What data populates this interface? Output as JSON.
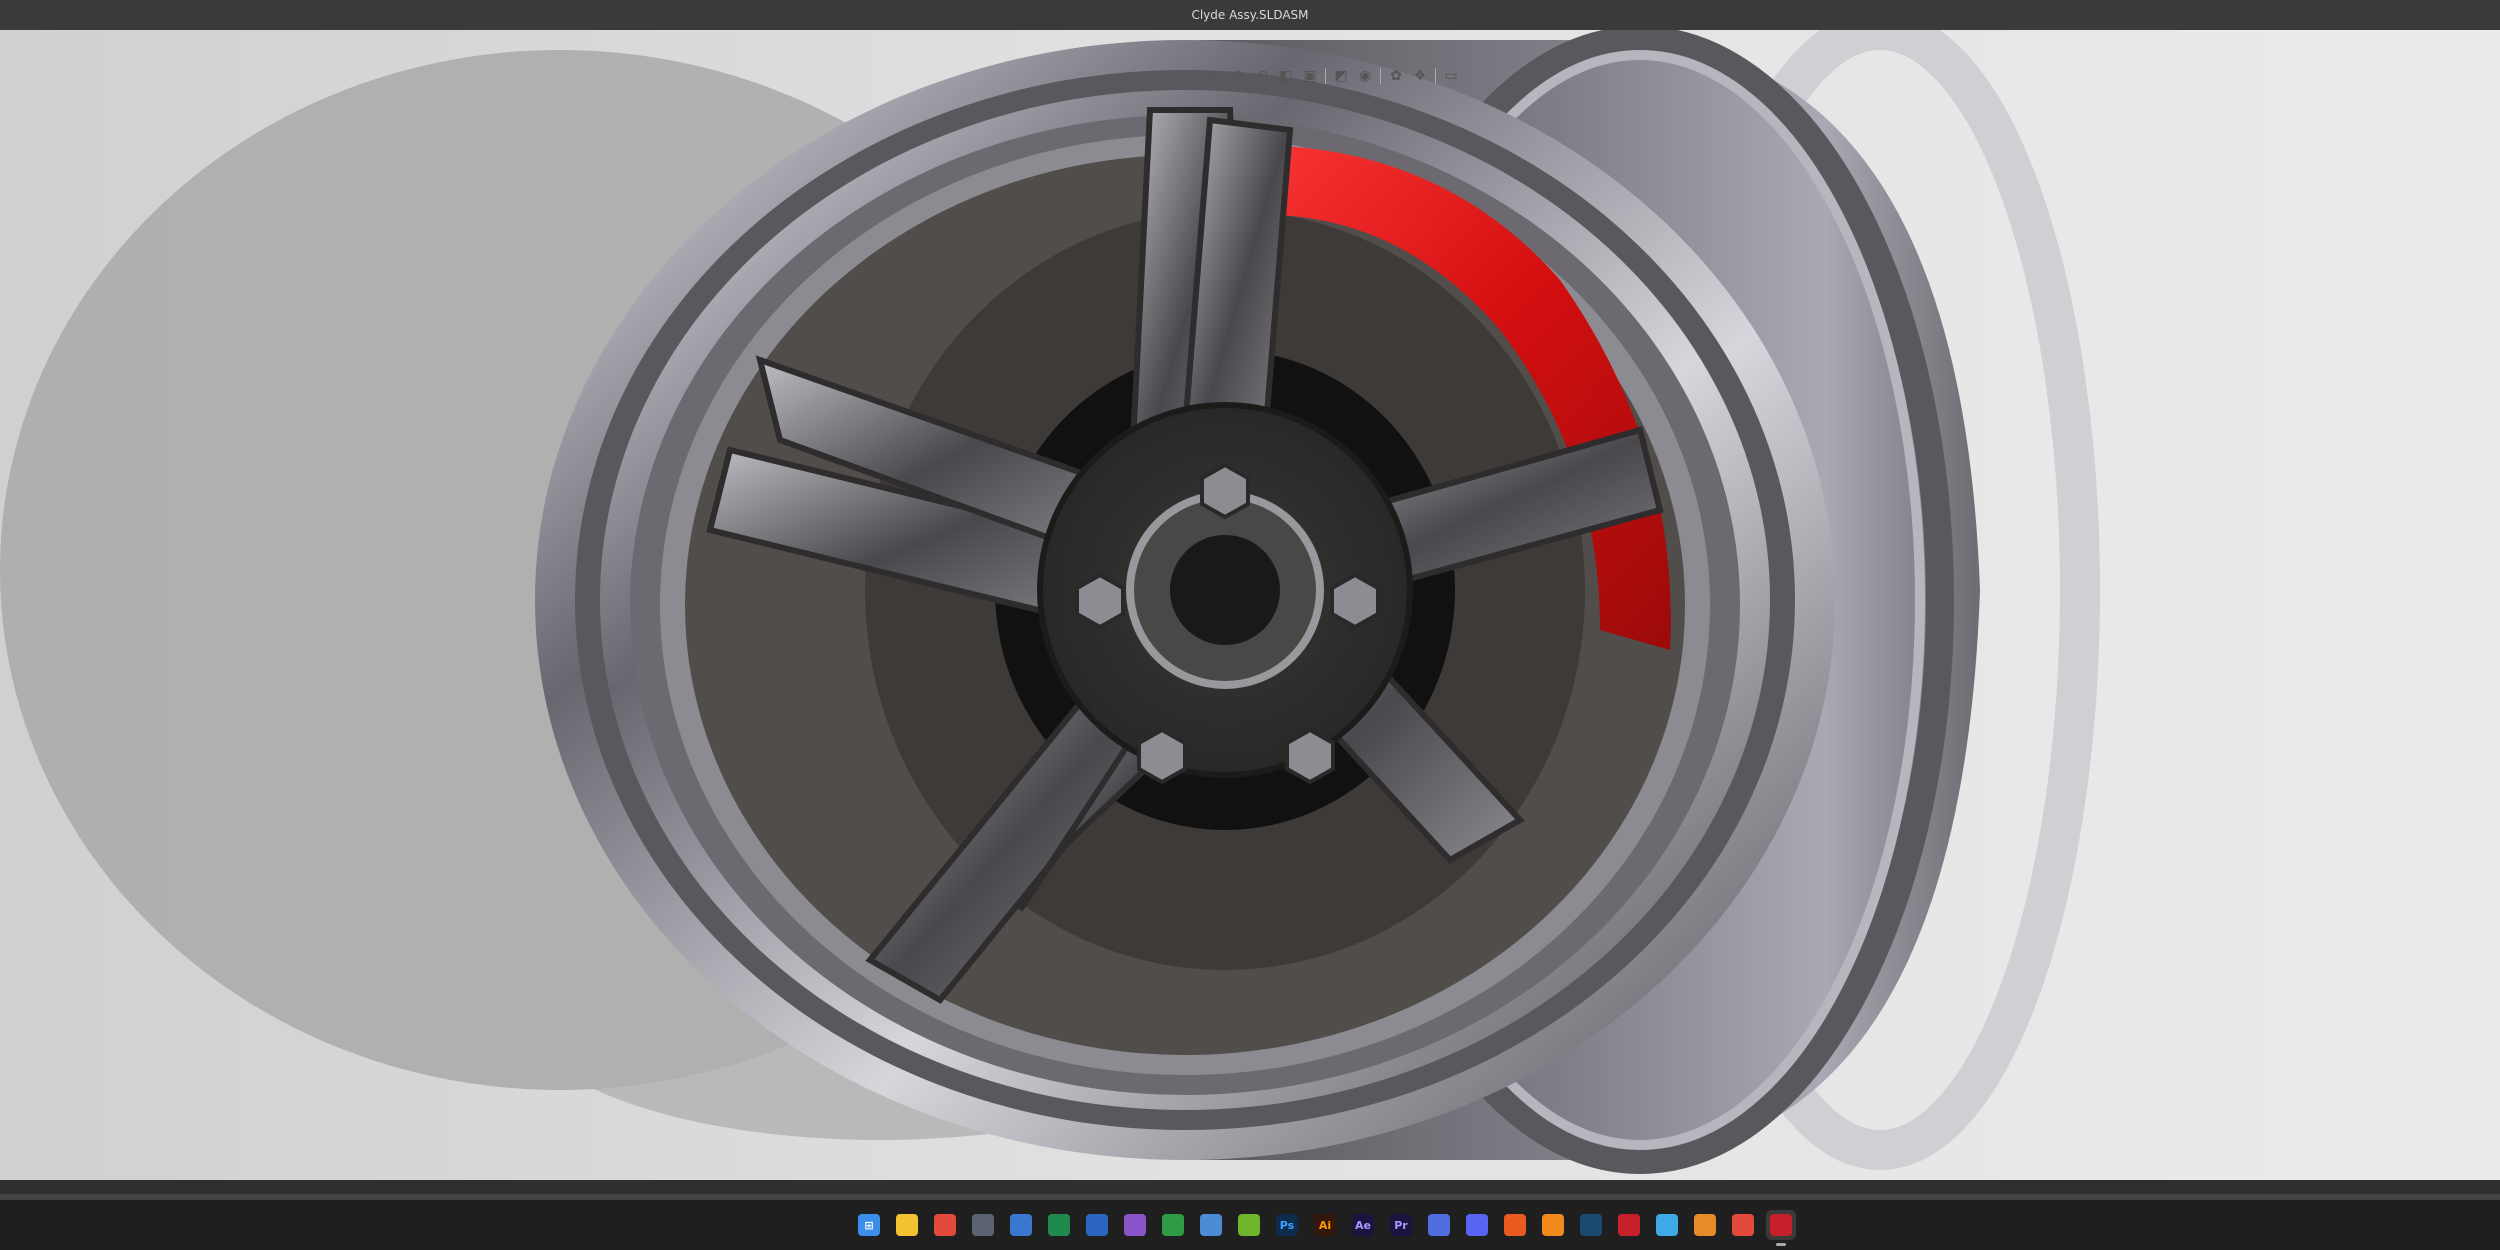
{
  "window": {
    "title": "Clyde Assy.SLDASM"
  },
  "heads_up_toolbar": {
    "icons": [
      "zoom-to-fit-icon",
      "zoom-area-icon",
      "previous-view-icon",
      "section-view-icon",
      "view-orientation-icon",
      "display-style-icon",
      "hide-show-icon",
      "appearance-icon",
      "scene-icon",
      "display-settings-icon"
    ]
  },
  "taskbar": {
    "items": [
      {
        "name": "start-icon",
        "color": "#3b8eea",
        "glyph": "⊞"
      },
      {
        "name": "file-explorer-icon",
        "color": "#f2c230",
        "glyph": ""
      },
      {
        "name": "chrome-icon",
        "color": "#e24b3c",
        "glyph": ""
      },
      {
        "name": "calculator-icon",
        "color": "#5b6470",
        "glyph": ""
      },
      {
        "name": "store-icon",
        "color": "#3a77d1",
        "glyph": ""
      },
      {
        "name": "excel-icon",
        "color": "#1f8a4c",
        "glyph": ""
      },
      {
        "name": "word-icon",
        "color": "#2b66c2",
        "glyph": ""
      },
      {
        "name": "camera-icon",
        "color": "#8a55c8",
        "glyph": ""
      },
      {
        "name": "xbox-icon",
        "color": "#2f9c45",
        "glyph": ""
      },
      {
        "name": "notepad-icon",
        "color": "#4c8bd6",
        "glyph": ""
      },
      {
        "name": "nvidia-icon",
        "color": "#6eb42d",
        "glyph": ""
      },
      {
        "name": "photoshop-icon",
        "color": "#0d2b4d",
        "glyph": "Ps",
        "text": "#3fa2ff"
      },
      {
        "name": "illustrator-icon",
        "color": "#33170a",
        "glyph": "Ai",
        "text": "#ff9a00"
      },
      {
        "name": "after-effects-icon",
        "color": "#1b1440",
        "glyph": "Ae",
        "text": "#a59bff"
      },
      {
        "name": "premiere-icon",
        "color": "#1b1440",
        "glyph": "Pr",
        "text": "#a59bff"
      },
      {
        "name": "messenger-icon",
        "color": "#4f6fe0",
        "glyph": ""
      },
      {
        "name": "discord-icon",
        "color": "#5865f2",
        "glyph": ""
      },
      {
        "name": "oculus-icon",
        "color": "#e85a1f",
        "glyph": ""
      },
      {
        "name": "fusion-icon",
        "color": "#f08a1c",
        "glyph": ""
      },
      {
        "name": "steam-icon",
        "color": "#1b4a73",
        "glyph": ""
      },
      {
        "name": "solidworks-2026-icon",
        "color": "#c8202b",
        "glyph": ""
      },
      {
        "name": "3d-viewer-icon",
        "color": "#3fa9e8",
        "glyph": ""
      },
      {
        "name": "blender-icon",
        "color": "#e88a2a",
        "glyph": ""
      },
      {
        "name": "chrome-profile-icon",
        "color": "#e24b3c",
        "glyph": ""
      },
      {
        "name": "solidworks-2026-active-icon",
        "color": "#c8202b",
        "glyph": ""
      }
    ]
  }
}
